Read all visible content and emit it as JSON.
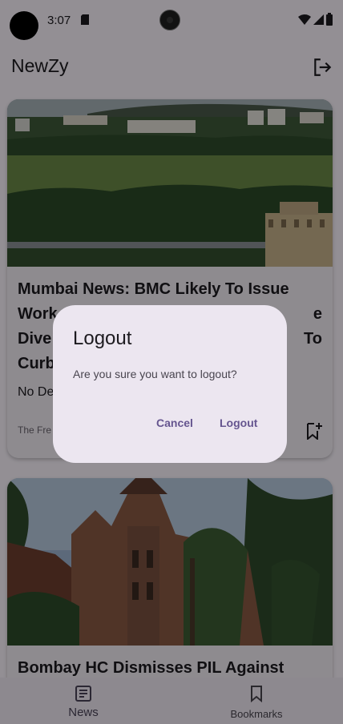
{
  "status_bar": {
    "time": "3:07"
  },
  "app_bar": {
    "title": "NewZy",
    "action_icon": "logout-icon"
  },
  "articles": [
    {
      "title": "Mumbai News: BMC Likely To Issue Work... e Dive... To Curb...",
      "title_lines": [
        "Mumbai News: BMC Likely To Issue",
        "Work",
        "e",
        "Dive",
        "To",
        "Curb"
      ],
      "description": "No De",
      "source": "The Fre",
      "image": "mumbai-green-landscape"
    },
    {
      "title": "Bombay HC Dismisses PIL Against",
      "image": "bombay-high-court-building"
    }
  ],
  "bottom_nav": {
    "items": [
      {
        "label": "News",
        "icon": "article-icon",
        "selected": true
      },
      {
        "label": "Bookmarks",
        "icon": "bookmark-icon",
        "selected": false
      }
    ]
  },
  "dialog": {
    "title": "Logout",
    "message": "Are you sure you want to logout?",
    "cancel_label": "Cancel",
    "confirm_label": "Logout"
  },
  "colors": {
    "primary": "#65558f",
    "surface": "#fdf7ff",
    "dialog_surface": "#ece6f0",
    "scrim": "rgba(0,0,0,0.42)"
  }
}
